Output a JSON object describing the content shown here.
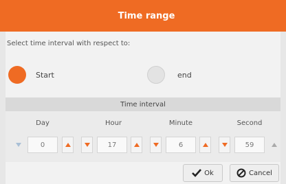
{
  "header": {
    "title": "Time range"
  },
  "prompt": "Select time interval with respect to:",
  "reference": {
    "options": [
      {
        "label": "Start",
        "selected": true
      },
      {
        "label": "end",
        "selected": false
      }
    ]
  },
  "interval": {
    "title": "Time interval",
    "fields": [
      {
        "label": "Day",
        "value": "0"
      },
      {
        "label": "Hour",
        "value": "17"
      },
      {
        "label": "Minute",
        "value": "6"
      },
      {
        "label": "Second",
        "value": "59"
      }
    ]
  },
  "footer": {
    "ok_label": "Ok",
    "cancel_label": "Cancel"
  },
  "colors": {
    "accent": "#ef6b23"
  }
}
